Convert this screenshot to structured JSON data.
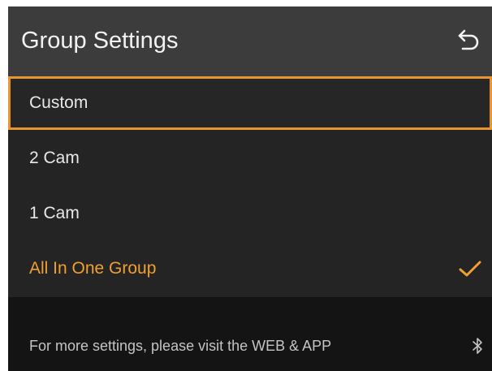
{
  "header": {
    "title": "Group Settings",
    "back_icon": "back-arrow-icon"
  },
  "options": [
    {
      "label": "Custom",
      "focused": true,
      "selected": false
    },
    {
      "label": "2 Cam",
      "focused": false,
      "selected": false
    },
    {
      "label": "1 Cam",
      "focused": false,
      "selected": false
    },
    {
      "label": "All In One Group",
      "focused": false,
      "selected": true
    }
  ],
  "footer": {
    "text": "For more settings, please visit the WEB & APP",
    "icon": "bluetooth-icon"
  },
  "colors": {
    "accent": "#f0a030",
    "focus_border": "#e8952e",
    "header_bg": "#3c3c3c",
    "list_bg": "#242424",
    "footer_bg": "#141414"
  }
}
